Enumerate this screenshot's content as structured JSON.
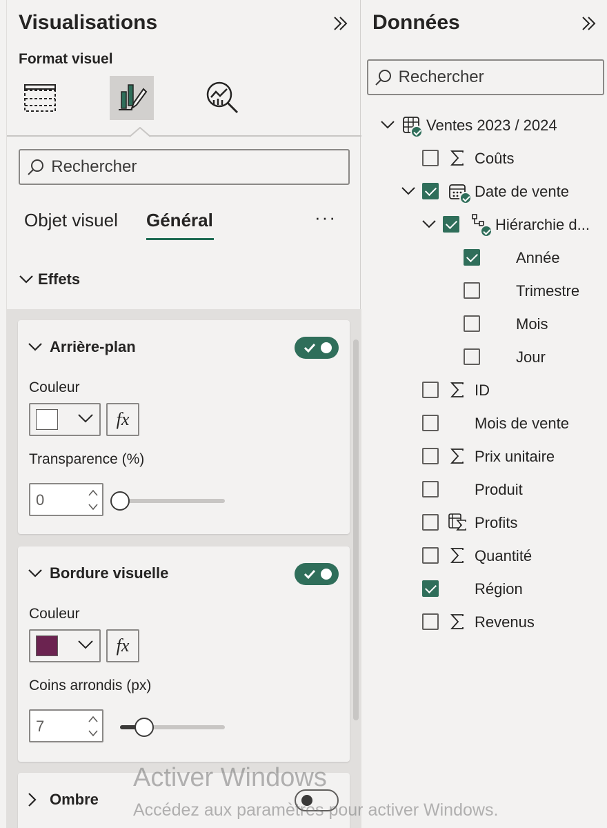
{
  "visualizations": {
    "title": "Visualisations",
    "subtitle": "Format visuel",
    "icon_tabs": [
      {
        "name": "build-visual-icon",
        "active": false
      },
      {
        "name": "format-visual-icon",
        "active": true
      },
      {
        "name": "analytics-icon",
        "active": false
      }
    ],
    "search_placeholder": "Rechercher",
    "tabs": [
      "Objet visuel",
      "Général"
    ],
    "active_tab": "Général",
    "more_label": "···",
    "section": {
      "label": "Effets",
      "expanded": true
    },
    "cards": {
      "background": {
        "title": "Arrière-plan",
        "toggle_on": true,
        "color_label": "Couleur",
        "color_value": "#ffffff",
        "fx_label": "fx",
        "transparency_label": "Transparence (%)",
        "transparency_value": "0",
        "transparency_fraction": 0
      },
      "border": {
        "title": "Bordure visuelle",
        "toggle_on": true,
        "color_label": "Couleur",
        "color_value": "#6b2350",
        "fx_label": "fx",
        "radius_label": "Coins arrondis (px)",
        "radius_value": "7",
        "radius_fraction": 0.23
      },
      "shadow": {
        "title": "Ombre",
        "toggle_on": false
      }
    }
  },
  "data": {
    "title": "Données",
    "search_placeholder": "Rechercher",
    "table": {
      "label": "Ventes 2023 / 2024",
      "expanded": true
    },
    "date_field": {
      "label": "Date de vente",
      "checked": true,
      "expanded": true
    },
    "hierarchy": {
      "label": "Hiérarchie d...",
      "checked": true,
      "expanded": true
    },
    "hierarchy_levels": [
      {
        "label": "Année",
        "checked": true
      },
      {
        "label": "Trimestre",
        "checked": false
      },
      {
        "label": "Mois",
        "checked": false
      },
      {
        "label": "Jour",
        "checked": false
      }
    ],
    "fields_top": [
      {
        "label": "Coûts",
        "checked": false,
        "icon": "sigma-icon"
      }
    ],
    "fields": [
      {
        "label": "ID",
        "checked": false,
        "icon": "sigma-icon"
      },
      {
        "label": "Mois de vente",
        "checked": false,
        "icon": ""
      },
      {
        "label": "Prix unitaire",
        "checked": false,
        "icon": "sigma-icon"
      },
      {
        "label": "Produit",
        "checked": false,
        "icon": ""
      },
      {
        "label": "Profits",
        "checked": false,
        "icon": "measure-icon"
      },
      {
        "label": "Quantité",
        "checked": false,
        "icon": "sigma-icon"
      },
      {
        "label": "Région",
        "checked": true,
        "icon": ""
      },
      {
        "label": "Revenus",
        "checked": false,
        "icon": "sigma-icon"
      }
    ]
  },
  "watermark": {
    "line1": "Activer Windows",
    "line2": "Accédez aux paramètres pour activer Windows."
  },
  "colors": {
    "accent": "#2f6e5a",
    "underline": "#1f6b53",
    "pane_bg": "#f3f2f1"
  }
}
